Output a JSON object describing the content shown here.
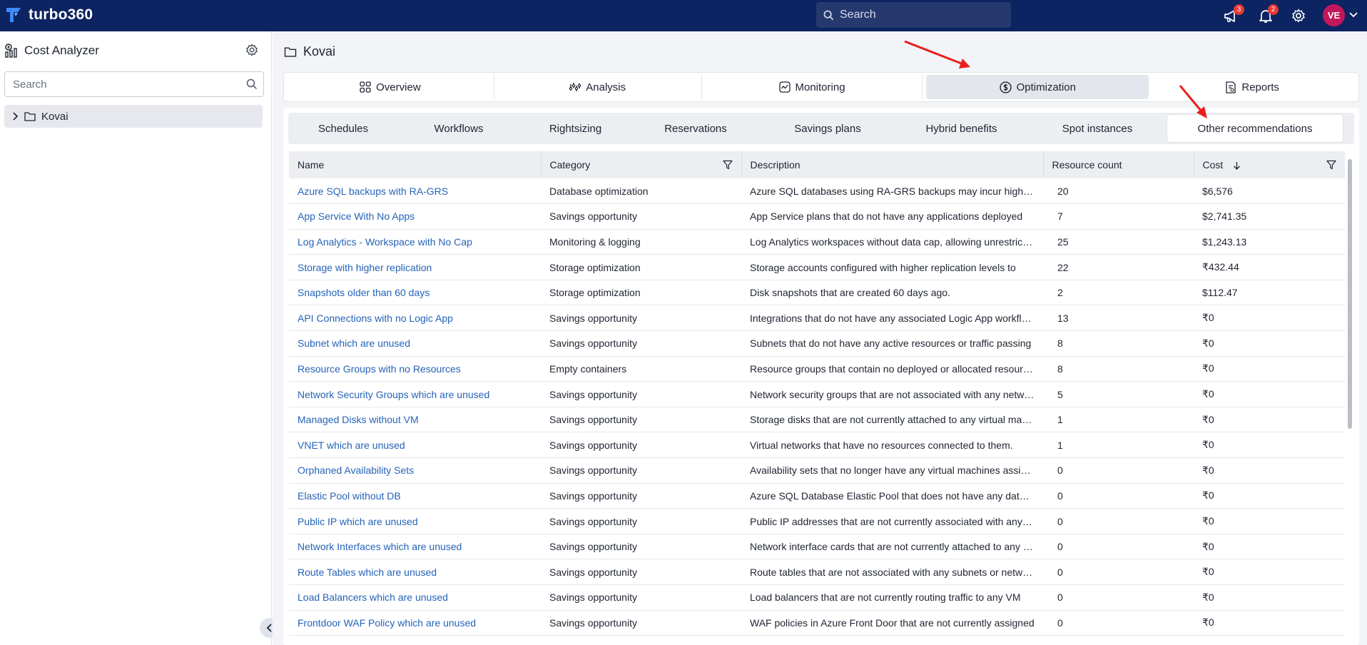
{
  "app": {
    "name": "turbo360",
    "search_placeholder": "Search",
    "announcements_count": "3",
    "notifications_count": "2",
    "user_initials": "VE"
  },
  "sidebar": {
    "title": "Cost Analyzer",
    "search_placeholder": "Search",
    "tree": [
      {
        "label": "Kovai"
      }
    ]
  },
  "breadcrumb": {
    "label": "Kovai"
  },
  "main_tabs": [
    {
      "label": "Overview",
      "icon": "grid-icon"
    },
    {
      "label": "Analysis",
      "icon": "analysis-icon"
    },
    {
      "label": "Monitoring",
      "icon": "monitoring-icon"
    },
    {
      "label": "Optimization",
      "icon": "dollar-icon",
      "active": true
    },
    {
      "label": "Reports",
      "icon": "report-icon"
    }
  ],
  "sub_tabs": [
    {
      "label": "Schedules"
    },
    {
      "label": "Workflows"
    },
    {
      "label": "Rightsizing"
    },
    {
      "label": "Reservations"
    },
    {
      "label": "Savings plans"
    },
    {
      "label": "Hybrid benefits"
    },
    {
      "label": "Spot instances"
    },
    {
      "label": "Other recommendations",
      "active": true
    }
  ],
  "table": {
    "columns": [
      "Name",
      "Category",
      "Description",
      "Resource count",
      "Cost"
    ],
    "rows": [
      [
        "Azure SQL backups with RA-GRS",
        "Database optimization",
        "Azure SQL databases using RA-GRS backups may incur higher costs",
        "20",
        "$6,576"
      ],
      [
        "App Service With No Apps",
        "Savings opportunity",
        "App Service plans that do not have any applications deployed",
        "7",
        "$2,741.35"
      ],
      [
        "Log Analytics - Workspace with No Cap",
        "Monitoring & logging",
        "Log Analytics workspaces without data cap, allowing unrestricted ingestion",
        "25",
        "$1,243.13"
      ],
      [
        "Storage with higher replication",
        "Storage optimization",
        "Storage accounts configured with higher replication levels to",
        "22",
        "₹432.44"
      ],
      [
        "Snapshots older than 60 days",
        "Storage optimization",
        "Disk snapshots that are created 60 days ago.",
        "2",
        "$112.47"
      ],
      [
        "API Connections with no Logic App",
        "Savings opportunity",
        "Integrations that do not have any associated Logic App workflows",
        "13",
        "₹0"
      ],
      [
        "Subnet which are unused",
        "Savings opportunity",
        "Subnets that do not have any active resources or traffic passing",
        "8",
        "₹0"
      ],
      [
        "Resource Groups with no Resources",
        "Empty containers",
        "Resource groups that contain no deployed or allocated resources",
        "8",
        "₹0"
      ],
      [
        "Network Security Groups which are unused",
        "Savings opportunity",
        "Network security groups that are not associated with any network",
        "5",
        "₹0"
      ],
      [
        "Managed Disks without VM",
        "Savings opportunity",
        "Storage disks that are not currently attached to any virtual machine",
        "1",
        "₹0"
      ],
      [
        "VNET which are unused",
        "Savings opportunity",
        "Virtual networks that have no resources connected to them.",
        "1",
        "₹0"
      ],
      [
        "Orphaned Availability Sets",
        "Savings opportunity",
        "Availability sets that no longer have any virtual machines assigned",
        "0",
        "₹0"
      ],
      [
        "Elastic Pool without DB",
        "Savings opportunity",
        "Azure SQL Database Elastic Pool that does not have any databases",
        "0",
        "₹0"
      ],
      [
        "Public IP which are unused",
        "Savings opportunity",
        "Public IP addresses that are not currently associated with any resource",
        "0",
        "₹0"
      ],
      [
        "Network Interfaces which are unused",
        "Savings opportunity",
        "Network interface cards that are not currently attached to any VM",
        "0",
        "₹0"
      ],
      [
        "Route Tables which are unused",
        "Savings opportunity",
        "Route tables that are not associated with any subnets or networks",
        "0",
        "₹0"
      ],
      [
        "Load Balancers which are unused",
        "Savings opportunity",
        "Load balancers that are not currently routing traffic to any VM",
        "0",
        "₹0"
      ],
      [
        "Frontdoor WAF Policy which are unused",
        "Savings opportunity",
        "WAF policies in Azure Front Door that are not currently assigned",
        "0",
        "₹0"
      ]
    ]
  },
  "colors": {
    "topbar": "#0c2461",
    "link": "#2563b8",
    "annotation_arrow": "#e8201d"
  }
}
